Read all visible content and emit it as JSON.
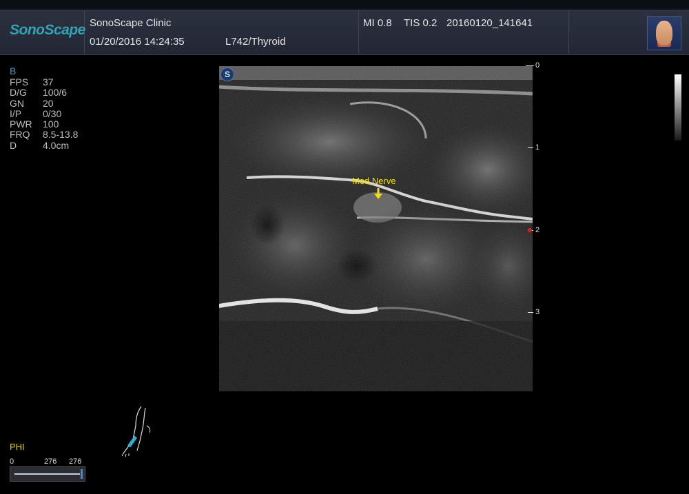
{
  "header": {
    "logo": "SonoScape",
    "clinic": "SonoScape Clinic",
    "datetime": "01/20/2016 14:24:35",
    "probe_preset": "L742/Thyroid",
    "mi": "MI  0.8",
    "tis": "TIS 0.2",
    "study_id": "20160120_141641"
  },
  "mode": "B",
  "params": [
    {
      "key": "FPS",
      "value": "37"
    },
    {
      "key": "D/G",
      "value": "100/6"
    },
    {
      "key": "GN",
      "value": "20"
    },
    {
      "key": "I/P",
      "value": "0/30"
    },
    {
      "key": "PWR",
      "value": "100"
    },
    {
      "key": "FRQ",
      "value": "8.5-13.8"
    },
    {
      "key": "D",
      "value": "4.0cm"
    }
  ],
  "image": {
    "logo_letter": "S",
    "annotation": "Med Nerve"
  },
  "depth_scale": [
    "0",
    "1",
    "2",
    "3"
  ],
  "colors": {
    "accent_logo": "#2fa4b4",
    "mode_blue": "#3d9bd6",
    "annotation_yellow": "#f0e000",
    "focus_marker": "#e02020"
  },
  "footer": {
    "phi_label": "PHI",
    "cine_start": "0",
    "cine_current": "276",
    "cine_total": "276"
  }
}
